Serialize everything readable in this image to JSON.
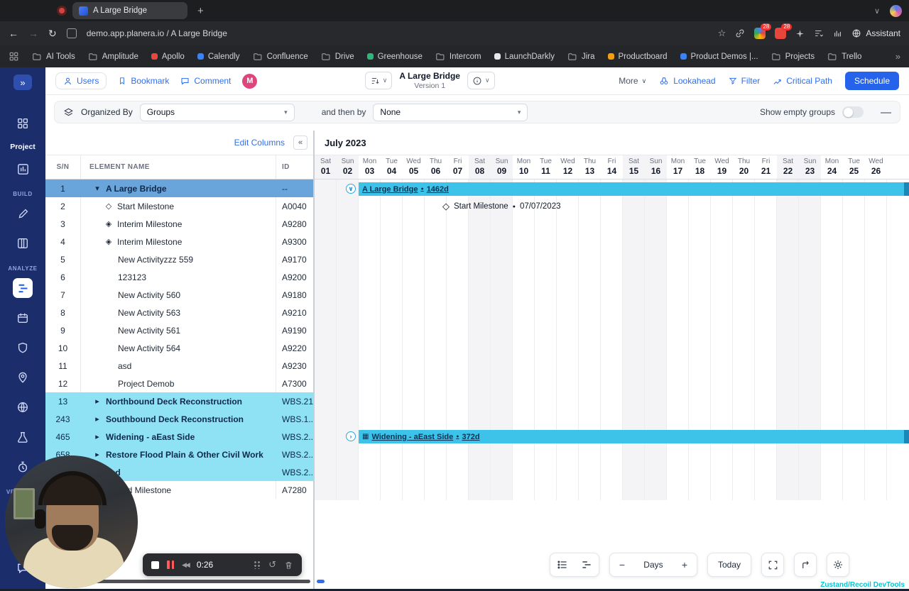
{
  "icons": {
    "plus": "+",
    "minus": "−",
    "minus_lg": "—",
    "chevron": "∨",
    "chevron_small": "▾",
    "chevron_right": "›",
    "collapse_left": "«",
    "expand_right": "»",
    "back": "←",
    "forward": "→",
    "reload": "↻",
    "star": "☆",
    "stop": "■",
    "rewind": "◀◀",
    "restart": "↺",
    "bullet": "●",
    "diamond": "◇",
    "grid_small": "▦"
  },
  "browser": {
    "tab_title": "A Large Bridge",
    "url": "demo.app.planera.io / A Large Bridge",
    "ext1_badge": "28",
    "ext2_badge": "28",
    "assistant": "Assistant",
    "bookmarks": [
      {
        "label": "AI Tools",
        "cls": ""
      },
      {
        "label": "Amplitude",
        "cls": ""
      },
      {
        "label": "Apollo",
        "cls": "dot dot-red"
      },
      {
        "label": "Calendly",
        "cls": "dot dot-blue"
      },
      {
        "label": "Confluence",
        "cls": ""
      },
      {
        "label": "Drive",
        "cls": ""
      },
      {
        "label": "Greenhouse",
        "cls": "dot dot-green"
      },
      {
        "label": "Intercom",
        "cls": ""
      },
      {
        "label": "LaunchDarkly",
        "cls": "dot dot-dark"
      },
      {
        "label": "Jira",
        "cls": ""
      },
      {
        "label": "Productboard",
        "cls": "dot dot-orange"
      },
      {
        "label": "Product Demos |...",
        "cls": "dot dot-blue"
      },
      {
        "label": "Projects",
        "cls": ""
      },
      {
        "label": "Trello",
        "cls": ""
      }
    ]
  },
  "sidebar": {
    "project": "Project",
    "build": "BUILD",
    "analyze": "ANALYZE",
    "versions": "VERSIONS"
  },
  "header": {
    "users": "Users",
    "bookmark": "Bookmark",
    "comment": "Comment",
    "avatar": "M",
    "title": "A Large Bridge",
    "version": "Version 1",
    "more": "More",
    "lookahead": "Lookahead",
    "filter": "Filter",
    "critical_path": "Critical Path",
    "schedule": "Schedule"
  },
  "filter_bar": {
    "organized_by": "Organized By",
    "organized_value": "Groups",
    "then_by": "and then by",
    "then_value": "None",
    "show_empty": "Show empty groups"
  },
  "table": {
    "edit_columns": "Edit Columns",
    "col_sn": "S/N",
    "col_name": "ELEMENT NAME",
    "col_id": "ID",
    "rows": [
      {
        "sn": "1",
        "icon": "▾",
        "name": "A Large Bridge",
        "id": "--",
        "cls": "hl-blue bold"
      },
      {
        "sn": "2",
        "icon": "◇",
        "name": "Start Milestone",
        "id": "A0040",
        "cls": "ind1"
      },
      {
        "sn": "3",
        "icon": "◈",
        "name": "Interim Milestone",
        "id": "A9280",
        "cls": "ind1"
      },
      {
        "sn": "4",
        "icon": "◈",
        "name": "Interim Milestone",
        "id": "A9300",
        "cls": "ind1"
      },
      {
        "sn": "5",
        "icon": "",
        "name": "New Activityzzz 559",
        "id": "A9170",
        "cls": "ind2"
      },
      {
        "sn": "6",
        "icon": "",
        "name": "123123",
        "id": "A9200",
        "cls": "ind2"
      },
      {
        "sn": "7",
        "icon": "",
        "name": "New Activity 560",
        "id": "A9180",
        "cls": "ind2"
      },
      {
        "sn": "8",
        "icon": "",
        "name": "New Activity 563",
        "id": "A9210",
        "cls": "ind2"
      },
      {
        "sn": "9",
        "icon": "",
        "name": "New Activity 561",
        "id": "A9190",
        "cls": "ind2"
      },
      {
        "sn": "10",
        "icon": "",
        "name": "New Activity 564",
        "id": "A9220",
        "cls": "ind2"
      },
      {
        "sn": "11",
        "icon": "",
        "name": "asd",
        "id": "A9230",
        "cls": "ind2"
      },
      {
        "sn": "12",
        "icon": "",
        "name": "Project Demob",
        "id": "A7300",
        "cls": "ind2"
      },
      {
        "sn": "13",
        "icon": "▸",
        "name": "Northbound Deck Reconstruction",
        "id": "WBS.21",
        "cls": "hl-cyan bold"
      },
      {
        "sn": "243",
        "icon": "▸",
        "name": "Southbound Deck Reconstruction",
        "id": "WBS.1...",
        "cls": "hl-cyan bold"
      },
      {
        "sn": "465",
        "icon": "▸",
        "name": "Widening - aEast Side",
        "id": "WBS.2...",
        "cls": "hl-cyan bold"
      },
      {
        "sn": "658",
        "icon": "▸",
        "name": "Restore Flood Plain & Other Civil Work",
        "id": "WBS.2...",
        "cls": "hl-cyan bold"
      },
      {
        "sn": "",
        "icon": "▸",
        "name": "asd",
        "id": "WBS.2...",
        "cls": "hl-cyan bold"
      },
      {
        "sn": "",
        "icon": "◇",
        "name": "End Milestone",
        "id": "A7280",
        "cls": "ind1"
      }
    ]
  },
  "gantt": {
    "month": "July 2023",
    "days": [
      {
        "d": "Sat",
        "n": "01",
        "we": true
      },
      {
        "d": "Sun",
        "n": "02",
        "we": true
      },
      {
        "d": "Mon",
        "n": "03"
      },
      {
        "d": "Tue",
        "n": "04"
      },
      {
        "d": "Wed",
        "n": "05"
      },
      {
        "d": "Thu",
        "n": "06"
      },
      {
        "d": "Fri",
        "n": "07"
      },
      {
        "d": "Sat",
        "n": "08",
        "we": true
      },
      {
        "d": "Sun",
        "n": "09",
        "we": true
      },
      {
        "d": "Mon",
        "n": "10"
      },
      {
        "d": "Tue",
        "n": "11"
      },
      {
        "d": "Wed",
        "n": "12"
      },
      {
        "d": "Thu",
        "n": "13"
      },
      {
        "d": "Fri",
        "n": "14"
      },
      {
        "d": "Sat",
        "n": "15",
        "we": true
      },
      {
        "d": "Sun",
        "n": "16",
        "we": true
      },
      {
        "d": "Mon",
        "n": "17"
      },
      {
        "d": "Tue",
        "n": "18"
      },
      {
        "d": "Wed",
        "n": "19"
      },
      {
        "d": "Thu",
        "n": "20"
      },
      {
        "d": "Fri",
        "n": "21"
      },
      {
        "d": "Sat",
        "n": "22",
        "we": true
      },
      {
        "d": "Sun",
        "n": "23",
        "we": true
      },
      {
        "d": "Mon",
        "n": "24"
      },
      {
        "d": "Tue",
        "n": "25"
      },
      {
        "d": "Wed",
        "n": "26"
      }
    ],
    "bar1": {
      "label": "A Large Bridge",
      "duration": "1462d"
    },
    "milestone": {
      "label": "Start Milestone",
      "date": "07/07/2023"
    },
    "bar2": {
      "label": "Widening - aEast Side",
      "duration": "372d"
    }
  },
  "gantt_toolbar": {
    "zoom_unit": "Days",
    "today": "Today"
  },
  "recorder": {
    "time": "0:26"
  },
  "devtools": "Zustand/Recoil DevTools"
}
